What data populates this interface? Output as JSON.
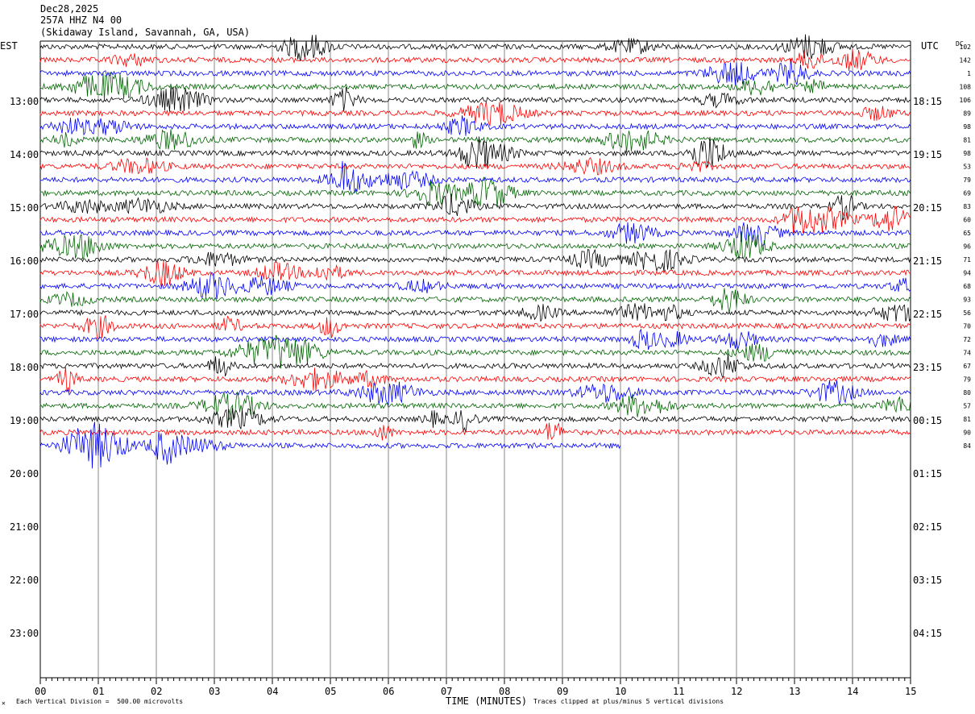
{
  "header": {
    "date": "Dec28,2025",
    "station": "257A HHZ N4 00",
    "location": "(Skidaway Island, Savannah, GA, USA)"
  },
  "left_zone": "EST",
  "right_zone": "UTC",
  "dc_label": "DC",
  "footer": {
    "corner_mark": "✕",
    "scale_note": "Each Vertical Division =  500.00 microvolts",
    "clip_note": "Traces clipped at plus/minus 5 vertical divisions"
  },
  "colors": {
    "black": "#000000",
    "red": "#ff0000",
    "blue": "#0000ff",
    "green": "#006400",
    "grid": "#888888"
  },
  "chart_data": {
    "type": "line",
    "title": "257A HHZ N4 00",
    "xlabel": "TIME (MINUTES)",
    "xlim": [
      0,
      15
    ],
    "x_ticks": [
      "00",
      "01",
      "02",
      "03",
      "04",
      "05",
      "06",
      "07",
      "08",
      "09",
      "10",
      "11",
      "12",
      "13",
      "14",
      "15"
    ],
    "left_hour_labels": [
      "13:00",
      "14:00",
      "15:00",
      "16:00",
      "17:00",
      "18:00",
      "19:00",
      "20:00",
      "21:00",
      "22:00",
      "23:00"
    ],
    "right_hour_labels": [
      "18:15",
      "19:15",
      "20:15",
      "21:15",
      "22:15",
      "23:15",
      "00:15",
      "01:15",
      "02:15",
      "03:15",
      "04:15"
    ],
    "trace_color_cycle": [
      "black",
      "red",
      "blue",
      "green"
    ],
    "trace_count": 31,
    "last_trace_end_minute": 10,
    "dc_offsets": [
      "102",
      "142",
      "1",
      "108",
      "106",
      "89",
      "98",
      "81",
      "98",
      "53",
      "79",
      "69",
      "83",
      "60",
      "65",
      "96",
      "71",
      "94",
      "68",
      "93",
      "56",
      "70",
      "72",
      "74",
      "67",
      "79",
      "80",
      "57",
      "81",
      "90",
      "84"
    ]
  }
}
